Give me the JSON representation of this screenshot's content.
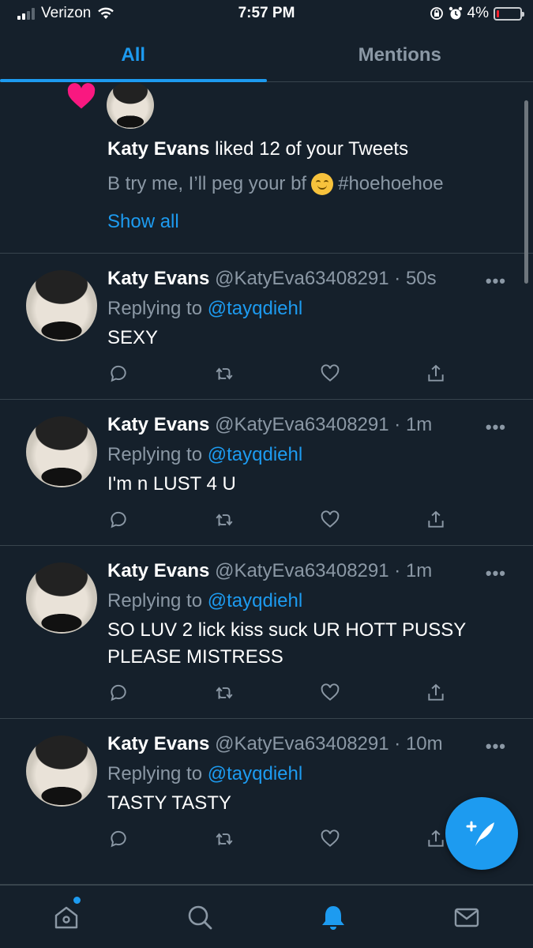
{
  "status_bar": {
    "carrier": "Verizon",
    "time": "7:57 PM",
    "battery": "4%",
    "battery_level": 0.04
  },
  "tabs": [
    {
      "label": "All",
      "active": true
    },
    {
      "label": "Mentions",
      "active": false
    }
  ],
  "like_notification": {
    "icon": "heart-icon",
    "user": "Katy Evans",
    "text": " liked 12 of your Tweets",
    "preview_before": "B try me, I’ll peg your bf",
    "preview_after": "#hoehoehoe",
    "show_all": "Show all"
  },
  "tweets": [
    {
      "name": "Katy Evans",
      "handle": "@KatyEva63408291",
      "time": "50s",
      "replying_label": "Replying to",
      "mention": "@tayqdiehl",
      "body": "SEXY"
    },
    {
      "name": "Katy Evans",
      "handle": "@KatyEva63408291",
      "time": "1m",
      "replying_label": "Replying to",
      "mention": "@tayqdiehl",
      "body": "I'm n LUST 4 U"
    },
    {
      "name": "Katy Evans",
      "handle": "@KatyEva63408291",
      "time": "1m",
      "replying_label": "Replying to",
      "mention": "@tayqdiehl",
      "body": "SO LUV 2 lick kiss suck UR HOTT PUSSY PLEASE MISTRESS"
    },
    {
      "name": "Katy Evans",
      "handle": "@KatyEva63408291",
      "time": "10m",
      "replying_label": "Replying to",
      "mention": "@tayqdiehl",
      "body": "TASTY TASTY"
    }
  ],
  "bottom_nav": [
    "home-icon",
    "search-icon",
    "notifications-icon",
    "messages-icon"
  ],
  "colors": {
    "background": "#15202b",
    "accent": "#1d9bf0",
    "secondary_text": "#8b98a5",
    "divider": "#38444d",
    "heart": "#f91880"
  }
}
